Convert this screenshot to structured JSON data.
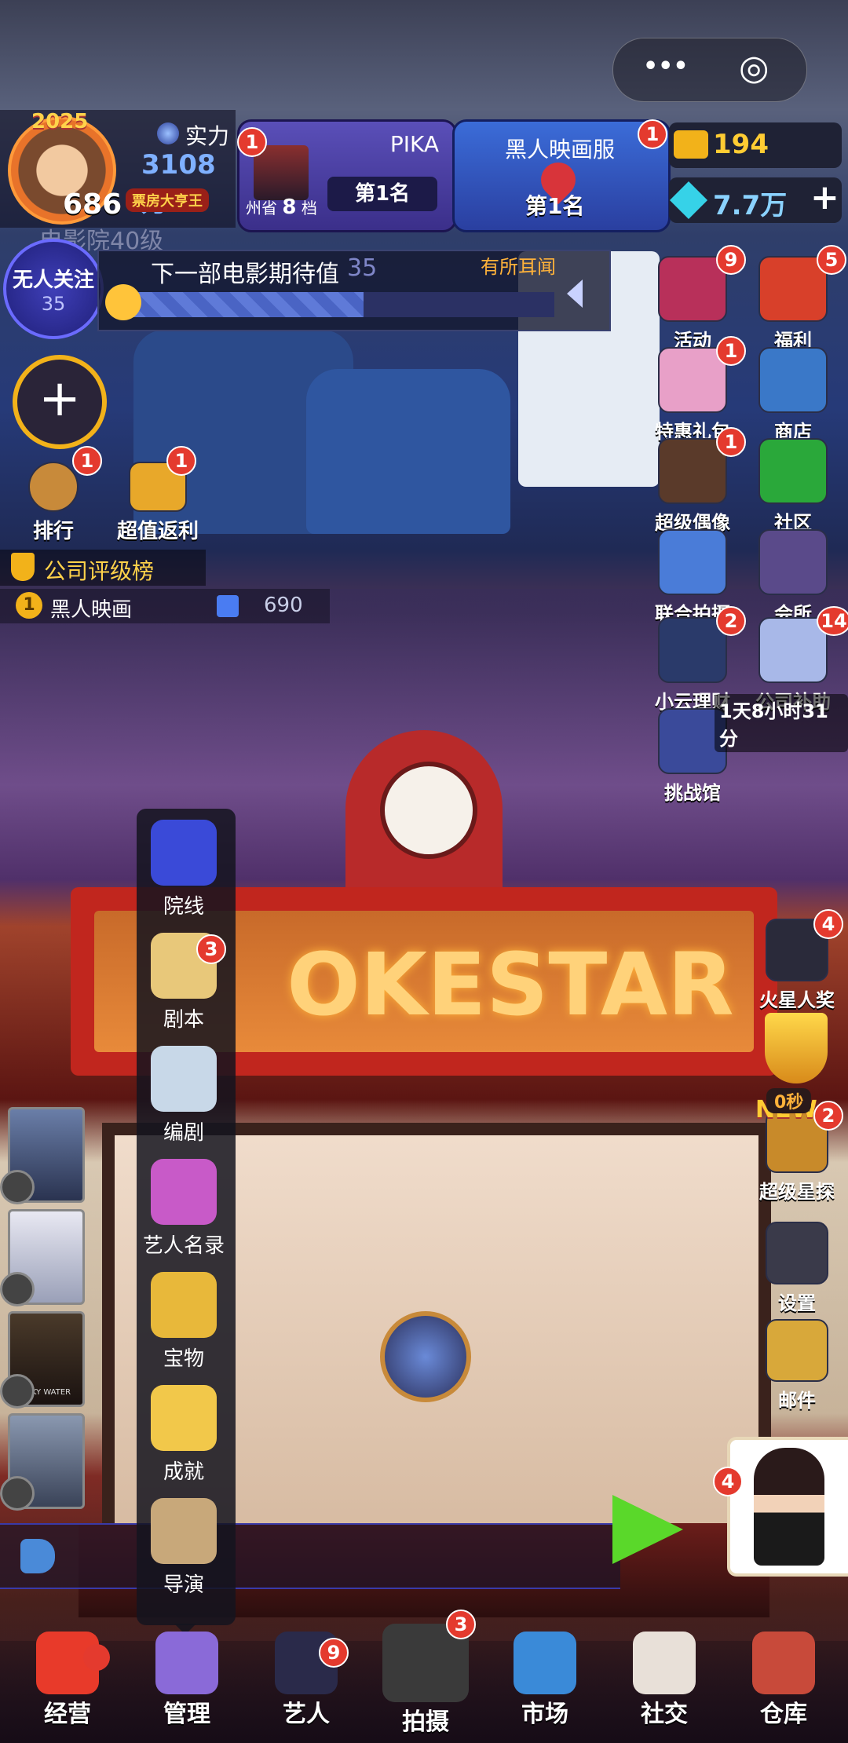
{
  "player": {
    "avatar_year": "2025",
    "level": "686",
    "strength_label": "实力",
    "strength_value": "3108万",
    "title_badge": "票房大亨王",
    "cinema_level": "电影院40级"
  },
  "rank_left": {
    "name": "PIKA",
    "region": "州省",
    "tier": "8",
    "tier_suffix": "档",
    "rank": "第1名",
    "badge": "1"
  },
  "rank_right": {
    "name": "黑人映画服",
    "rank": "第1名",
    "badge": "1"
  },
  "currency": {
    "gold": "194",
    "diamond": "7.7万",
    "plus": "+",
    "badge": "1"
  },
  "follow": {
    "label": "无人关注",
    "count": "35"
  },
  "expectation": {
    "label": "下一部电影期待值",
    "value": "35",
    "hint": "有所耳闻",
    "progress": 0.55
  },
  "left_buttons": [
    {
      "label": "排行",
      "badge": "1"
    },
    {
      "label": "超值返利",
      "badge": "1"
    }
  ],
  "company_board": {
    "title": "公司评级榜",
    "rank": "1",
    "name": "黑人映画",
    "score": "690"
  },
  "right_top": [
    {
      "label": "活动",
      "badge": "9"
    },
    {
      "label": "福利",
      "badge": "5"
    },
    {
      "label": "特惠礼包",
      "badge": "1"
    },
    {
      "label": "商店",
      "badge": ""
    },
    {
      "label": "超级偶像",
      "badge": "1"
    },
    {
      "label": "社区",
      "badge": ""
    },
    {
      "label": "联合拍摄",
      "badge": ""
    },
    {
      "label": "会所",
      "badge": ""
    },
    {
      "label": "小云理财",
      "badge": "2"
    },
    {
      "label": "公司补助",
      "badge": "14"
    },
    {
      "label": "挑战馆",
      "badge": ""
    }
  ],
  "subsidy_timer": "1天8小时31分",
  "right_bottom": [
    {
      "label": "火星人奖",
      "badge": "4"
    },
    {
      "label": "超级星探",
      "badge": "2",
      "tag": "NEW"
    },
    {
      "label": "设置",
      "badge": ""
    },
    {
      "label": "邮件",
      "badge": ""
    }
  ],
  "trophy_timer": "0秒",
  "theater_sign": "OKESTAR",
  "manage_menu": [
    {
      "label": "院线",
      "badge": ""
    },
    {
      "label": "剧本",
      "badge": "3"
    },
    {
      "label": "编剧",
      "badge": ""
    },
    {
      "label": "艺人名录",
      "badge": ""
    },
    {
      "label": "宝物",
      "badge": ""
    },
    {
      "label": "成就",
      "badge": ""
    },
    {
      "label": "导演",
      "badge": ""
    }
  ],
  "film_thumb_text": "SMOKY WATER",
  "assistant_badge": "4",
  "bottom_nav": [
    {
      "label": "经营",
      "badge": "dot"
    },
    {
      "label": "管理",
      "badge": ""
    },
    {
      "label": "艺人",
      "badge": "9"
    },
    {
      "label": "拍摄",
      "badge": "3"
    },
    {
      "label": "市场",
      "badge": ""
    },
    {
      "label": "社交",
      "badge": ""
    },
    {
      "label": "仓库",
      "badge": ""
    }
  ],
  "window_controls": {
    "more": "•••",
    "close": "◎"
  },
  "colors": {
    "accent_blue": "#3b3fb8",
    "badge_red": "#e43a2e",
    "gold": "#ffcc33",
    "progress_blue": "#5f7ad8"
  }
}
